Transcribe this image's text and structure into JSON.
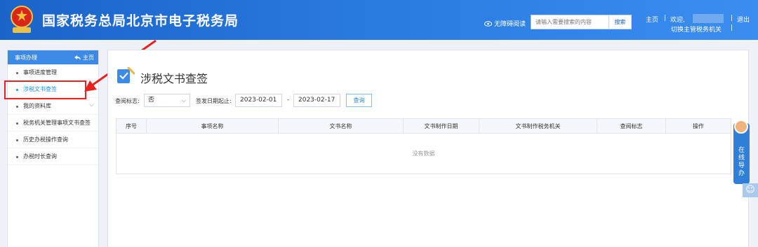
{
  "header": {
    "title": "国家税务总局北京市电子税务局",
    "accessible_label": "无障碍阅读",
    "search_placeholder": "请输入需要搜索的内容",
    "search_button": "搜索",
    "home": "主页",
    "separator": "|",
    "welcome": "欢迎,",
    "switch_org": "切换主管税务机关",
    "logout": "退出"
  },
  "sidebar": {
    "heading": "事项办理",
    "home_label": "主页",
    "items": [
      {
        "label": "事项进度管理"
      },
      {
        "label": "涉税文书查签"
      },
      {
        "label": "我的资料库"
      },
      {
        "label": "税务机关管理事项文书查签"
      },
      {
        "label": "历史办税操作查询"
      },
      {
        "label": "办税时长查询"
      }
    ]
  },
  "page": {
    "title": "涉税文书查签",
    "filters": {
      "viewed_label": "查阅标志:",
      "viewed_value": "否",
      "date_label": "签发日期起止:",
      "date_from": "2023-02-01",
      "date_separator": "-",
      "date_to": "2023-02-17",
      "query_button": "查询"
    },
    "table": {
      "columns": [
        "序号",
        "事项名称",
        "文书名称",
        "文书制作日期",
        "文书制作税务机关",
        "查阅标志",
        "操作"
      ],
      "empty_text": "没有数据"
    }
  },
  "float_widget": {
    "label": [
      "在",
      "线",
      "导",
      "办"
    ]
  },
  "colors": {
    "header_blue": "#1a63c9",
    "accent_blue": "#1a8fe8",
    "annotation_red": "#e8221c"
  }
}
